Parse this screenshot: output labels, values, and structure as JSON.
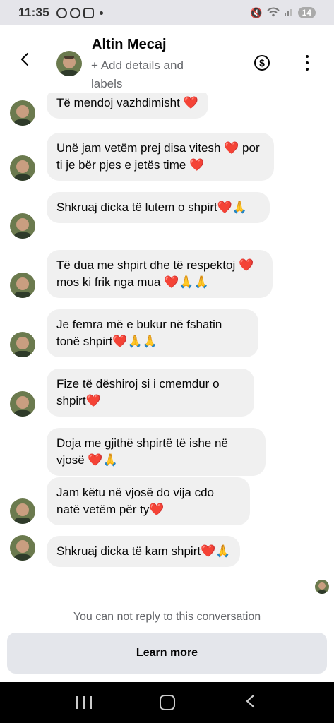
{
  "status_bar": {
    "time": "11:35",
    "battery": "14"
  },
  "header": {
    "contact_name": "Altin Mecaj",
    "subtitle": "+ Add details and labels",
    "money_icon": "dollar-circle-icon",
    "more_icon": "vertical-ellipsis-icon",
    "back_icon": "chevron-left-icon"
  },
  "messages": [
    {
      "text": "Të mendoj vazhdimisht ❤️"
    },
    {
      "text": "Unë jam vetëm prej disa vitesh ❤️ por ti je bër pjes e jetës time ❤️"
    },
    {
      "text": "Shkruaj dicka të lutem o shpirt❤️🙏"
    },
    {
      "text": "Të dua me shpirt dhe të respektoj ❤️ mos ki frik nga mua ❤️🙏🙏"
    },
    {
      "text": "Je femra më e bukur në fshatin tonë shpirt❤️🙏🙏"
    },
    {
      "text": "Fize të dëshiroj si i cmemdur o shpirt❤️"
    },
    {
      "text": "Doja me gjithë shpirtë të ishe në vjosë ❤️🙏"
    },
    {
      "text": "Jam këtu në vjosë do vija cdo natë vetëm për ty❤️"
    },
    {
      "text": "Shkruaj dicka të kam shpirt❤️🙏"
    }
  ],
  "footer": {
    "notice": "You can not reply to this conversation",
    "learn_more_label": "Learn more"
  },
  "colors": {
    "bubble_bg": "#f0f0f0",
    "status_bar_bg": "#e5e5ea",
    "button_bg": "#e4e6eb"
  }
}
